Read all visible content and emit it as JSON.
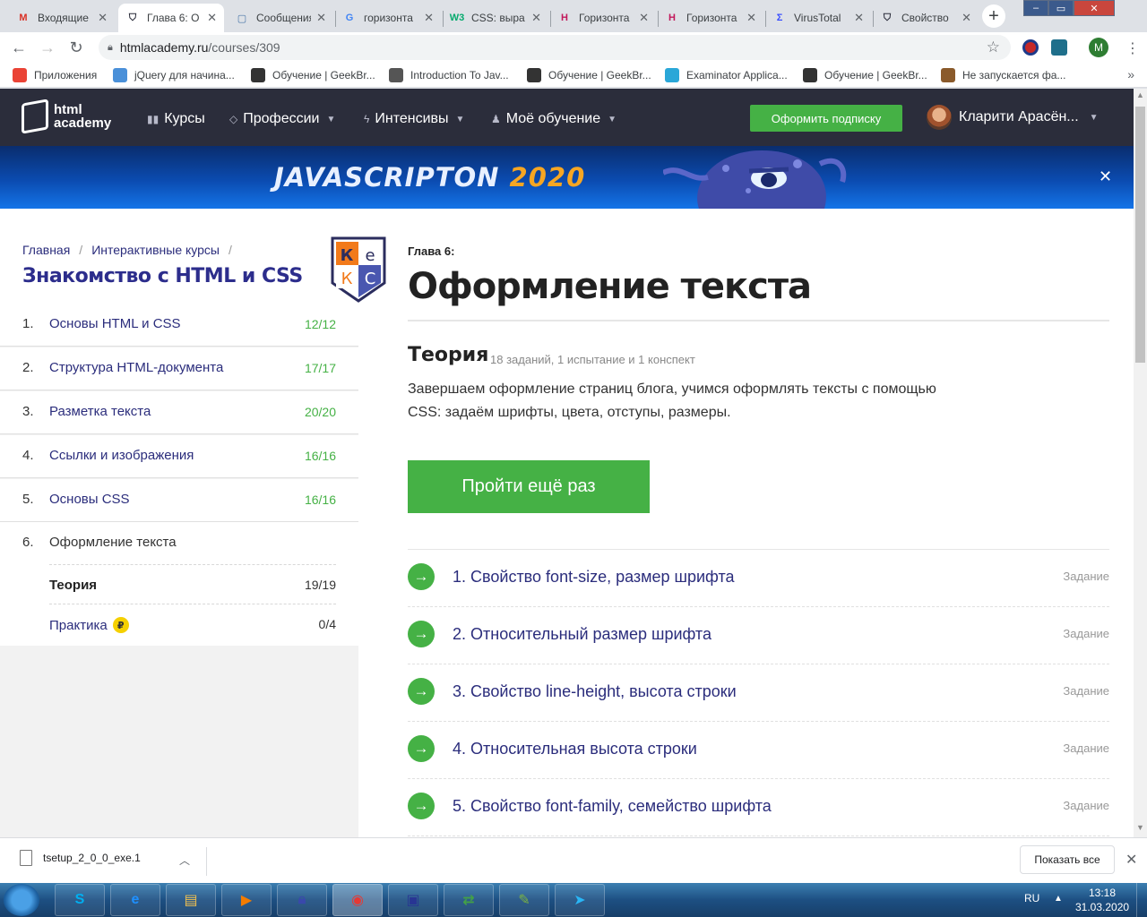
{
  "browser": {
    "tabs": [
      {
        "title": "Входящие",
        "favicon": "gmail-icon",
        "color": "#d93025",
        "glyph": "M"
      },
      {
        "title": "Глава 6: О",
        "favicon": "htmlacademy-icon",
        "color": "#2b2d3b",
        "glyph": "⛉",
        "active": true
      },
      {
        "title": "Сообщения",
        "favicon": "vk-icon",
        "color": "#4a76a8",
        "glyph": "▢"
      },
      {
        "title": "горизонта",
        "favicon": "google-icon",
        "color": "#4285f4",
        "glyph": "G"
      },
      {
        "title": "CSS: выра",
        "favicon": "w3schools-icon",
        "color": "#04aa6d",
        "glyph": "W3"
      },
      {
        "title": "Горизонта",
        "favicon": "htmlbook-icon",
        "color": "#c2185b",
        "glyph": "H"
      },
      {
        "title": "Горизонта",
        "favicon": "htmlbook-icon",
        "color": "#c2185b",
        "glyph": "H"
      },
      {
        "title": "VirusTotal",
        "favicon": "virustotal-icon",
        "color": "#394eff",
        "glyph": "Σ"
      },
      {
        "title": "Свойство",
        "favicon": "htmlacademy-icon",
        "color": "#2b2d3b",
        "glyph": "⛉"
      }
    ],
    "url_host": "htmlacademy.ru",
    "url_path": "/courses/309",
    "bookmarks": [
      {
        "label": "Приложения",
        "icon": "apps-grid-icon",
        "color": "#ea4335"
      },
      {
        "label": "jQuery для начина...",
        "icon": "bookmark-icon",
        "color": "#4a90d9"
      },
      {
        "label": "Обучение | GeekBr...",
        "icon": "geekbrains-icon",
        "color": "#333333"
      },
      {
        "label": "Introduction To Jav...",
        "icon": "bookmark-icon",
        "color": "#555555"
      },
      {
        "label": "Обучение | GeekBr...",
        "icon": "geekbrains-icon",
        "color": "#333333"
      },
      {
        "label": "Examinator Applica...",
        "icon": "chat-icon",
        "color": "#2aa7d8"
      },
      {
        "label": "Обучение | GeekBr...",
        "icon": "geekbrains-icon",
        "color": "#333333"
      },
      {
        "label": "Не запускается фа...",
        "icon": "bookmark-icon",
        "color": "#8a5a2b"
      }
    ],
    "profile_letter": "M"
  },
  "site": {
    "logo_line1": "html",
    "logo_line2": "academy",
    "nav": [
      {
        "label": "Курсы",
        "icon": "bars-icon"
      },
      {
        "label": "Профессии",
        "icon": "gem-icon"
      },
      {
        "label": "Интенсивы",
        "icon": "bolt-icon"
      },
      {
        "label": "Моё обучение",
        "icon": "people-icon"
      }
    ],
    "subscribe_label": "Оформить подписку",
    "user_name": "Кларити Арасён...",
    "banner_text": "JAVASCRIPTON",
    "banner_year": "2020",
    "accent": "#45b145"
  },
  "sidebar": {
    "breadcrumbs": [
      "Главная",
      "Интерактивные курсы"
    ],
    "course_title": "Знакомство с HTML и CSS",
    "badge_letters": [
      "К",
      "е",
      "К",
      "С"
    ],
    "chapters": [
      {
        "num": "1.",
        "name": "Основы HTML и CSS",
        "count": "12/12"
      },
      {
        "num": "2.",
        "name": "Структура HTML-документа",
        "count": "17/17"
      },
      {
        "num": "3.",
        "name": "Разметка текста",
        "count": "20/20"
      },
      {
        "num": "4.",
        "name": "Ссылки и изображения",
        "count": "16/16"
      },
      {
        "num": "5.",
        "name": "Основы CSS",
        "count": "16/16"
      },
      {
        "num": "6.",
        "name": "Оформление текста",
        "count": ""
      }
    ],
    "subitems": [
      {
        "name": "Теория",
        "count": "19/19"
      },
      {
        "name": "Практика",
        "count": "0/4",
        "coin": "₽"
      }
    ]
  },
  "main": {
    "chapter_label": "Глава 6:",
    "title": "Оформление текста",
    "theory_heading": "Теория",
    "theory_meta": "18 заданий, 1 испытание и 1 конспект",
    "theory_desc": "Завершаем оформление страниц блога, учимся оформлять тексты с помощью CSS: задаём шрифты, цвета, отступы, размеры.",
    "retry_label": "Пройти ещё раз",
    "tasks": [
      {
        "title": "1. Свойство font-size, размер шрифта",
        "type": "Задание"
      },
      {
        "title": "2. Относительный размер шрифта",
        "type": "Задание"
      },
      {
        "title": "3. Свойство line-height, высота строки",
        "type": "Задание"
      },
      {
        "title": "4. Относительная высота строки",
        "type": "Задание"
      },
      {
        "title": "5. Свойство font-family, семейство шрифта",
        "type": "Задание"
      }
    ]
  },
  "downloads": {
    "file": "tsetup_2_0_0_exe.1",
    "show_all": "Показать все"
  },
  "taskbar": {
    "apps": [
      "skype-icon",
      "ie-icon",
      "explorer-icon",
      "media-player-icon",
      "keepass-icon",
      "chrome-icon",
      "floppy-icon",
      "network-icon",
      "notepad-icon",
      "telegram-icon"
    ],
    "lang": "RU",
    "time": "13:18",
    "date": "31.03.2020"
  }
}
